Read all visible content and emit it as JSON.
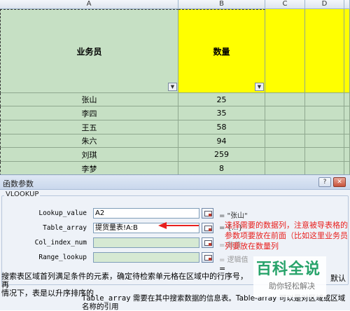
{
  "sheet": {
    "columns": [
      "A",
      "B",
      "C",
      "D"
    ],
    "header": {
      "salesperson": "业务员",
      "quantity": "数量"
    },
    "rows": [
      {
        "name": "张山",
        "qty": "25"
      },
      {
        "name": "李四",
        "qty": "35"
      },
      {
        "name": "王五",
        "qty": "58"
      },
      {
        "name": "朱六",
        "qty": "94"
      },
      {
        "name": "刘琪",
        "qty": "259"
      },
      {
        "name": "李梦",
        "qty": "8"
      }
    ],
    "colors": {
      "green": "#c6e0c4",
      "yellow": "#ffff00"
    }
  },
  "dialog": {
    "title": "函数参数",
    "function_name": "VLOOKUP",
    "args": [
      {
        "label": "Lookup_value",
        "value": "A2",
        "result": "= \"张山\"",
        "empty": false
      },
      {
        "label": "Table_array",
        "value": "提货量表!A:B",
        "result": "= {...}",
        "empty": false
      },
      {
        "label": "Col_index_num",
        "value": "",
        "result": "= 数值",
        "empty": true
      },
      {
        "label": "Range_lookup",
        "value": "",
        "result": "= 逻辑值",
        "empty": true
      }
    ],
    "equals": "=",
    "description_main": "搜索表区域首列满足条件的元素，确定待检索单元格在区域中的行序号，再",
    "description_main2": "情况下，表是以升序排序的",
    "description_right": "默认",
    "arg_description_name": "Table_array",
    "arg_description_text": "需要在其中搜索数据的信息表。Table-array 可以是对区域或区域名称的引用",
    "buttons": {
      "help": "?",
      "close": "✕"
    }
  },
  "annotation": {
    "text": "选择需要的数据列，注意被导表格的参数项要放在前面（比如这里业务员列要放在数量列",
    "color": "#e8201e"
  },
  "watermark": {
    "title": "百科全说",
    "subtitle": "助你轻松解决"
  }
}
